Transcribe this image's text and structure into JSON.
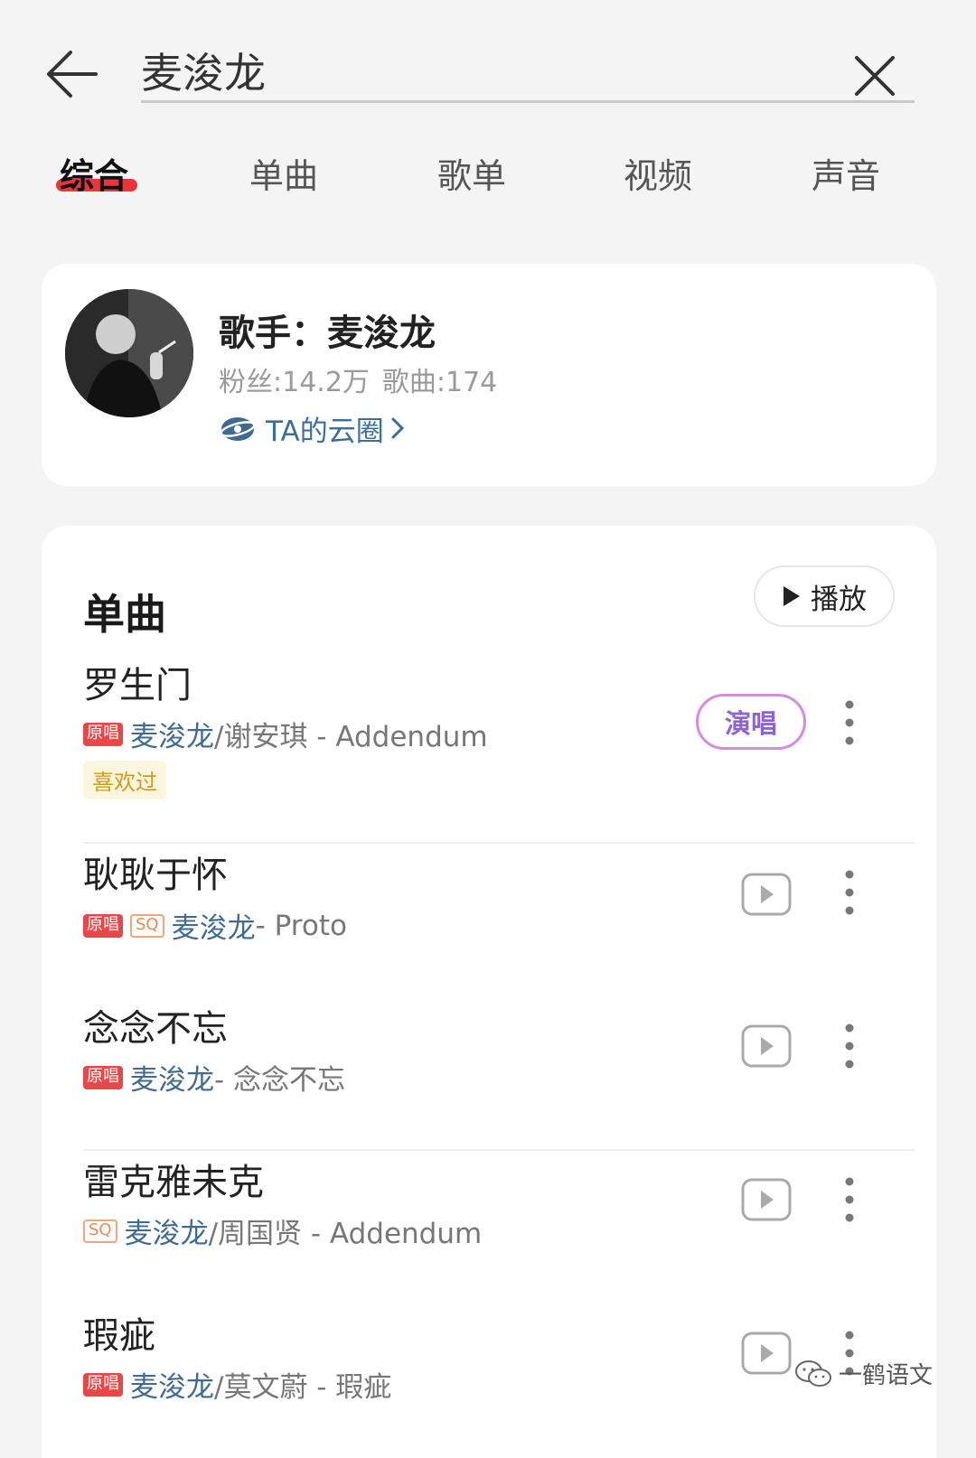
{
  "search": {
    "value": "麦浚龙"
  },
  "tabs": [
    {
      "label": "综合",
      "active": true
    },
    {
      "label": "单曲"
    },
    {
      "label": "歌单"
    },
    {
      "label": "视频"
    },
    {
      "label": "声音"
    }
  ],
  "colors": {
    "accent": "#e8363b",
    "link": "#3f6b93",
    "liked": "#d29b18"
  },
  "artist": {
    "name": "歌手：麦浚龙",
    "fans": "粉丝:14.2万",
    "songs": "歌曲:174",
    "cloud_link": "TA的云圈"
  },
  "songs_section": {
    "title": "单曲",
    "play_label": "播放",
    "items": [
      {
        "title": "罗生门",
        "badges": [
          "原唱"
        ],
        "artists": "麦浚龙",
        "others": "/谢安琪 - Addendum",
        "liked": "喜欢过",
        "action": "演唱"
      },
      {
        "title": "耿耿于怀",
        "badges": [
          "原唱",
          "SQ"
        ],
        "artists": "麦浚龙",
        "others": " - Proto"
      },
      {
        "title": "念念不忘",
        "badges": [
          "原唱"
        ],
        "artists": "麦浚龙",
        "others": " - 念念不忘"
      },
      {
        "title": "雷克雅未克",
        "badges": [
          "SQ"
        ],
        "artists": "麦浚龙",
        "others": "/周国贤 - Addendum"
      },
      {
        "title": "瑕疵",
        "badges": [
          "原唱"
        ],
        "artists": "麦浚龙",
        "others": "/莫文蔚 - 瑕疵"
      }
    ]
  },
  "watermark": "一鹤语文"
}
